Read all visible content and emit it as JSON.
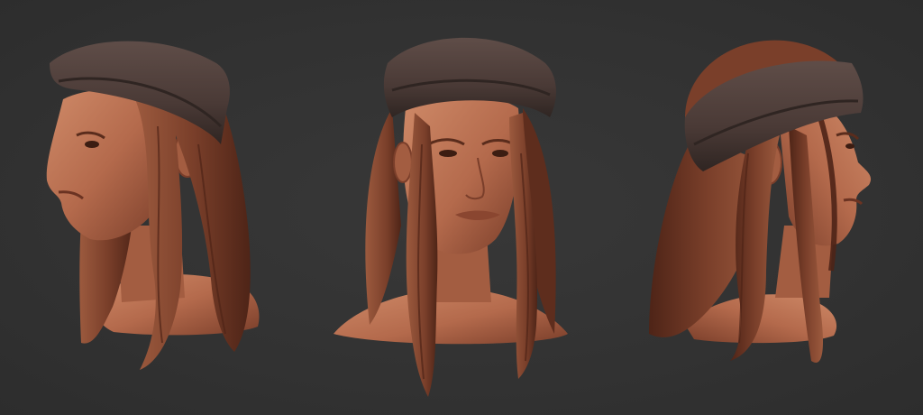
{
  "scene": {
    "background_color": "#333333",
    "materials": {
      "skin": "#b46a4c",
      "skin_shadow": "#7a3e2a",
      "skin_highlight": "#cf8a68",
      "hair": "#7a3f2a",
      "hair_dark": "#4e2417",
      "hair_light": "#9c5a3e",
      "headband": "#4a3a36",
      "headband_light": "#5f4d48",
      "headband_dark": "#2f2522"
    },
    "views": [
      {
        "view": "three-quarter-left"
      },
      {
        "view": "front"
      },
      {
        "view": "right-profile"
      }
    ]
  }
}
